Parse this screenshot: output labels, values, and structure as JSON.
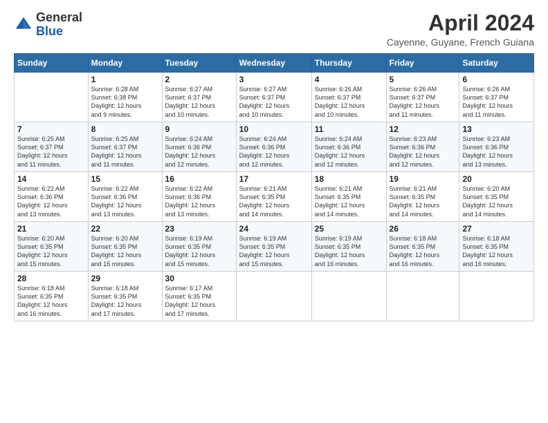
{
  "logo": {
    "general": "General",
    "blue": "Blue"
  },
  "title": "April 2024",
  "subtitle": "Cayenne, Guyane, French Guiana",
  "days_header": [
    "Sunday",
    "Monday",
    "Tuesday",
    "Wednesday",
    "Thursday",
    "Friday",
    "Saturday"
  ],
  "weeks": [
    [
      {
        "day": "",
        "info": ""
      },
      {
        "day": "1",
        "info": "Sunrise: 6:28 AM\nSunset: 6:38 PM\nDaylight: 12 hours\nand 9 minutes."
      },
      {
        "day": "2",
        "info": "Sunrise: 6:27 AM\nSunset: 6:37 PM\nDaylight: 12 hours\nand 10 minutes."
      },
      {
        "day": "3",
        "info": "Sunrise: 6:27 AM\nSunset: 6:37 PM\nDaylight: 12 hours\nand 10 minutes."
      },
      {
        "day": "4",
        "info": "Sunrise: 6:26 AM\nSunset: 6:37 PM\nDaylight: 12 hours\nand 10 minutes."
      },
      {
        "day": "5",
        "info": "Sunrise: 6:26 AM\nSunset: 6:37 PM\nDaylight: 12 hours\nand 11 minutes."
      },
      {
        "day": "6",
        "info": "Sunrise: 6:26 AM\nSunset: 6:37 PM\nDaylight: 12 hours\nand 11 minutes."
      }
    ],
    [
      {
        "day": "7",
        "info": "Sunrise: 6:25 AM\nSunset: 6:37 PM\nDaylight: 12 hours\nand 11 minutes."
      },
      {
        "day": "8",
        "info": "Sunrise: 6:25 AM\nSunset: 6:37 PM\nDaylight: 12 hours\nand 11 minutes."
      },
      {
        "day": "9",
        "info": "Sunrise: 6:24 AM\nSunset: 6:36 PM\nDaylight: 12 hours\nand 12 minutes."
      },
      {
        "day": "10",
        "info": "Sunrise: 6:24 AM\nSunset: 6:36 PM\nDaylight: 12 hours\nand 12 minutes."
      },
      {
        "day": "11",
        "info": "Sunrise: 6:24 AM\nSunset: 6:36 PM\nDaylight: 12 hours\nand 12 minutes."
      },
      {
        "day": "12",
        "info": "Sunrise: 6:23 AM\nSunset: 6:36 PM\nDaylight: 12 hours\nand 12 minutes."
      },
      {
        "day": "13",
        "info": "Sunrise: 6:23 AM\nSunset: 6:36 PM\nDaylight: 12 hours\nand 13 minutes."
      }
    ],
    [
      {
        "day": "14",
        "info": "Sunrise: 6:22 AM\nSunset: 6:36 PM\nDaylight: 12 hours\nand 13 minutes."
      },
      {
        "day": "15",
        "info": "Sunrise: 6:22 AM\nSunset: 6:36 PM\nDaylight: 12 hours\nand 13 minutes."
      },
      {
        "day": "16",
        "info": "Sunrise: 6:22 AM\nSunset: 6:36 PM\nDaylight: 12 hours\nand 13 minutes."
      },
      {
        "day": "17",
        "info": "Sunrise: 6:21 AM\nSunset: 6:35 PM\nDaylight: 12 hours\nand 14 minutes."
      },
      {
        "day": "18",
        "info": "Sunrise: 6:21 AM\nSunset: 6:35 PM\nDaylight: 12 hours\nand 14 minutes."
      },
      {
        "day": "19",
        "info": "Sunrise: 6:21 AM\nSunset: 6:35 PM\nDaylight: 12 hours\nand 14 minutes."
      },
      {
        "day": "20",
        "info": "Sunrise: 6:20 AM\nSunset: 6:35 PM\nDaylight: 12 hours\nand 14 minutes."
      }
    ],
    [
      {
        "day": "21",
        "info": "Sunrise: 6:20 AM\nSunset: 6:35 PM\nDaylight: 12 hours\nand 15 minutes."
      },
      {
        "day": "22",
        "info": "Sunrise: 6:20 AM\nSunset: 6:35 PM\nDaylight: 12 hours\nand 15 minutes."
      },
      {
        "day": "23",
        "info": "Sunrise: 6:19 AM\nSunset: 6:35 PM\nDaylight: 12 hours\nand 15 minutes."
      },
      {
        "day": "24",
        "info": "Sunrise: 6:19 AM\nSunset: 6:35 PM\nDaylight: 12 hours\nand 15 minutes."
      },
      {
        "day": "25",
        "info": "Sunrise: 6:19 AM\nSunset: 6:35 PM\nDaylight: 12 hours\nand 16 minutes."
      },
      {
        "day": "26",
        "info": "Sunrise: 6:18 AM\nSunset: 6:35 PM\nDaylight: 12 hours\nand 16 minutes."
      },
      {
        "day": "27",
        "info": "Sunrise: 6:18 AM\nSunset: 6:35 PM\nDaylight: 12 hours\nand 16 minutes."
      }
    ],
    [
      {
        "day": "28",
        "info": "Sunrise: 6:18 AM\nSunset: 6:35 PM\nDaylight: 12 hours\nand 16 minutes."
      },
      {
        "day": "29",
        "info": "Sunrise: 6:18 AM\nSunset: 6:35 PM\nDaylight: 12 hours\nand 17 minutes."
      },
      {
        "day": "30",
        "info": "Sunrise: 6:17 AM\nSunset: 6:35 PM\nDaylight: 12 hours\nand 17 minutes."
      },
      {
        "day": "",
        "info": ""
      },
      {
        "day": "",
        "info": ""
      },
      {
        "day": "",
        "info": ""
      },
      {
        "day": "",
        "info": ""
      }
    ]
  ]
}
